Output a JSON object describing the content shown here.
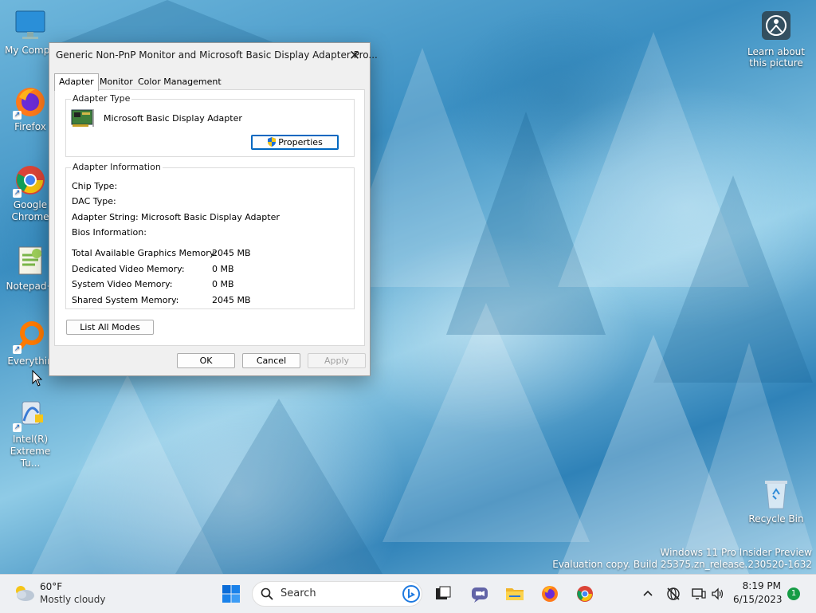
{
  "desktop": {
    "icons": [
      {
        "label": "My Compu",
        "icon": "computer-icon"
      },
      {
        "label": "Firefox",
        "icon": "firefox-icon"
      },
      {
        "label": "Google\nChrome",
        "icon": "chrome-icon"
      },
      {
        "label": "Notepad+",
        "icon": "notepad-plus-plus-icon"
      },
      {
        "label": "Everythin",
        "icon": "everything-search-icon"
      },
      {
        "label": "Intel(R)\nExtreme Tu...",
        "icon": "intel-xtu-icon"
      }
    ],
    "learn_about": "Learn about\nthis picture",
    "recycle_bin": "Recycle Bin"
  },
  "dialog": {
    "title": "Generic Non-PnP Monitor and Microsoft Basic Display Adapter Pro...",
    "tabs": [
      "Adapter",
      "Monitor",
      "Color Management"
    ],
    "adapter_type": {
      "group_label": "Adapter Type",
      "name": "Microsoft Basic Display Adapter",
      "properties_button": "Properties"
    },
    "adapter_info": {
      "group_label": "Adapter Information",
      "rows": [
        {
          "label": "Chip Type:",
          "value": ""
        },
        {
          "label": "DAC Type:",
          "value": ""
        },
        {
          "label": "Adapter String:",
          "value": "Microsoft Basic Display Adapter"
        },
        {
          "label": "Bios Information:",
          "value": ""
        }
      ],
      "memory": [
        {
          "label": "Total Available Graphics Memory:",
          "value": "2045 MB"
        },
        {
          "label": "Dedicated Video Memory:",
          "value": "0 MB"
        },
        {
          "label": "System Video Memory:",
          "value": "0 MB"
        },
        {
          "label": "Shared System Memory:",
          "value": "2045 MB"
        }
      ]
    },
    "list_all_modes": "List All Modes",
    "ok": "OK",
    "cancel": "Cancel",
    "apply": "Apply"
  },
  "watermark": {
    "line1": "Windows 11 Pro Insider Preview",
    "line2": "Evaluation copy. Build 25375.zn_release.230520-1632"
  },
  "taskbar": {
    "weather_temp": "60°F",
    "weather_desc": "Mostly cloudy",
    "search_placeholder": "Search",
    "time": "8:19 PM",
    "date": "6/15/2023",
    "notification_count": "1"
  },
  "colors": {
    "accent": "#0067c0",
    "taskbar_bg": "#eef0f3"
  }
}
